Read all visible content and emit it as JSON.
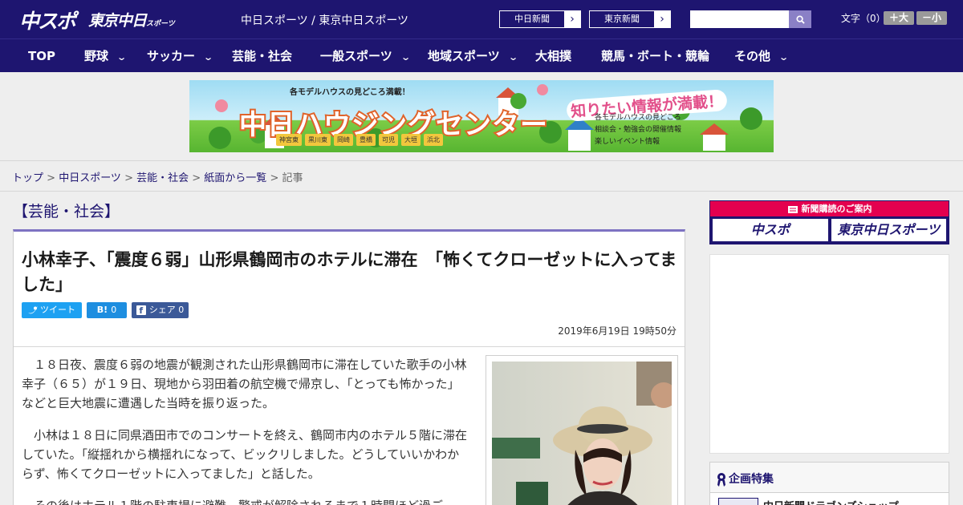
{
  "header": {
    "logo_chuspo": "中スポ",
    "logo_tokyo": "東京中日",
    "logo_tokyo_small": "スポーツ",
    "site_links": "中日スポーツ / 東京中日スポーツ",
    "paper_buttons": [
      "中日新聞",
      "東京新聞"
    ],
    "font_size_label": "文字（0）",
    "font_size_up": "＋大",
    "font_size_down": "－小"
  },
  "nav": {
    "items": [
      "TOP",
      "野球",
      "サッカー",
      "芸能・社会",
      "一般スポーツ",
      "地域スポーツ",
      "大相撲",
      "競馬・ボート・競輪",
      "その他"
    ]
  },
  "banner": {
    "subtitle": "各モデルハウスの見どころ満載！",
    "title": "中日ハウジングセンター",
    "catch": "知りたい情報が満載！",
    "towns": [
      "神宮東",
      "黒川東",
      "岡崎",
      "豊橋",
      "可児",
      "大垣",
      "浜北"
    ],
    "info": [
      "各モデルハウスの見どころ",
      "相談会・勉強会の開催情報",
      "楽しいイベント情報"
    ]
  },
  "breadcrumb": {
    "items": [
      "トップ",
      "中日スポーツ",
      "芸能・社会",
      "紙面から一覧"
    ],
    "current": "記事"
  },
  "article": {
    "category": "【芸能・社会】",
    "headline": "小林幸子、「震度６弱」山形県鶴岡市のホテルに滞在　「怖くてクローゼットに入ってました」",
    "share": {
      "tweet": "ツイート",
      "hatena_count": "0",
      "facebook": "シェア",
      "facebook_count": "0"
    },
    "date": "2019年6月19日 19時50分",
    "paragraphs": [
      "　１８日夜、震度６弱の地震が観測された山形県鶴岡市に滞在していた歌手の小林幸子（６５）が１９日、現地から羽田着の航空機で帰京し、「とっても怖かった」などと巨大地震に遭遇した当時を振り返った。",
      "　小林は１８日に同県酒田市でのコンサートを終え、鶴岡市内のホテル５階に滞在していた。「縦揺れから横揺れになって、ビックリしました。どうしていいかわからず、怖くてクローゼットに入ってました」と話した。",
      "　その後はホテル１階の駐車場に避難。警戒が解除されるまで１時間ほど過ご"
    ]
  },
  "sidebar": {
    "subscription_title": "新聞購読のご案内",
    "subscription_links": [
      "中スポ",
      "東京中日スポーツ"
    ],
    "special_title": "企画特集",
    "special_item": "中日新聞ドラゴンズショップ"
  },
  "colors": {
    "brand": "#1e1570",
    "accent": "#e4004f",
    "tweet": "#1da1f2",
    "facebook": "#3b5998"
  }
}
